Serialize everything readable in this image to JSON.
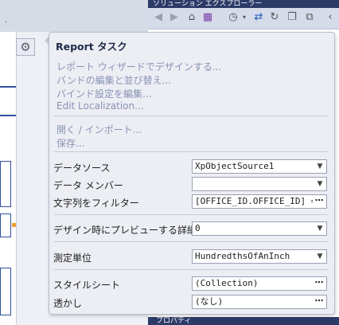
{
  "background": {
    "left_panel_dot": ".",
    "right_panel_title": "ソリューション エクスプローラー",
    "bottom_panel_title": "プロパティ",
    "toolbar_icons": [
      "back-icon",
      "forward-icon",
      "home-icon",
      "switch-views-icon",
      "history-icon",
      "sync-icon",
      "refresh-icon",
      "collapse-all-icon",
      "show-all-files-icon",
      "preview-icon"
    ]
  },
  "smart_tag": {
    "icon": "gear-icon"
  },
  "task_panel": {
    "title": "Report タスク",
    "links": [
      "レポート ウィザードでデザインする...",
      "バンドの編集と並び替え...",
      "バインド設定を編集...",
      "Edit Localization..."
    ],
    "links2": [
      "開く / インポート...",
      "保存..."
    ],
    "properties": {
      "data_source": {
        "label": "データソース",
        "value": "XpObjectSource1"
      },
      "data_member": {
        "label": "データ メンバー",
        "value": ""
      },
      "filter_string": {
        "label": "文字列をフィルター",
        "value": "[OFFICE_ID.OFFICE_ID] ="
      },
      "design_detail_count": {
        "label": "デザイン時にプレビューする詳細総数",
        "value": "0"
      },
      "measure_units": {
        "label": "測定単位",
        "value": "HundredthsOfAnInch"
      },
      "style_sheet": {
        "label": "スタイルシート",
        "value": "(Collection)"
      },
      "watermark": {
        "label": "透かし",
        "value": "(なし)"
      }
    }
  }
}
